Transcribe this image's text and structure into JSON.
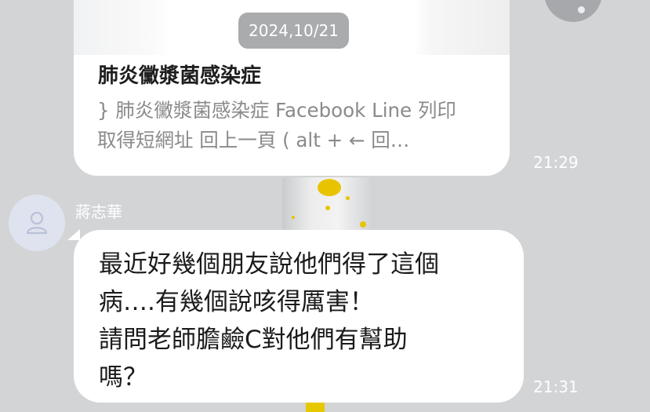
{
  "link_preview": {
    "date": "2024,10/21",
    "title": "肺炎黴漿菌感染症",
    "description": "} 肺炎黴漿菌感染症 Facebook Line 列印 取得短網址 回上一頁 ( alt + ← 回…",
    "time": "21:29"
  },
  "message": {
    "sender": "蔣志華",
    "lines": [
      "最近好幾個朋友說他們得了這個",
      "病….有幾個說咳得厲害！",
      "請問老師膽鹼C對他們有幫助",
      "嗎？"
    ],
    "time": "21:31"
  },
  "colors": {
    "background": "#d2d4d6",
    "bubble": "#ffffff",
    "date_pill": "#a9abad"
  }
}
